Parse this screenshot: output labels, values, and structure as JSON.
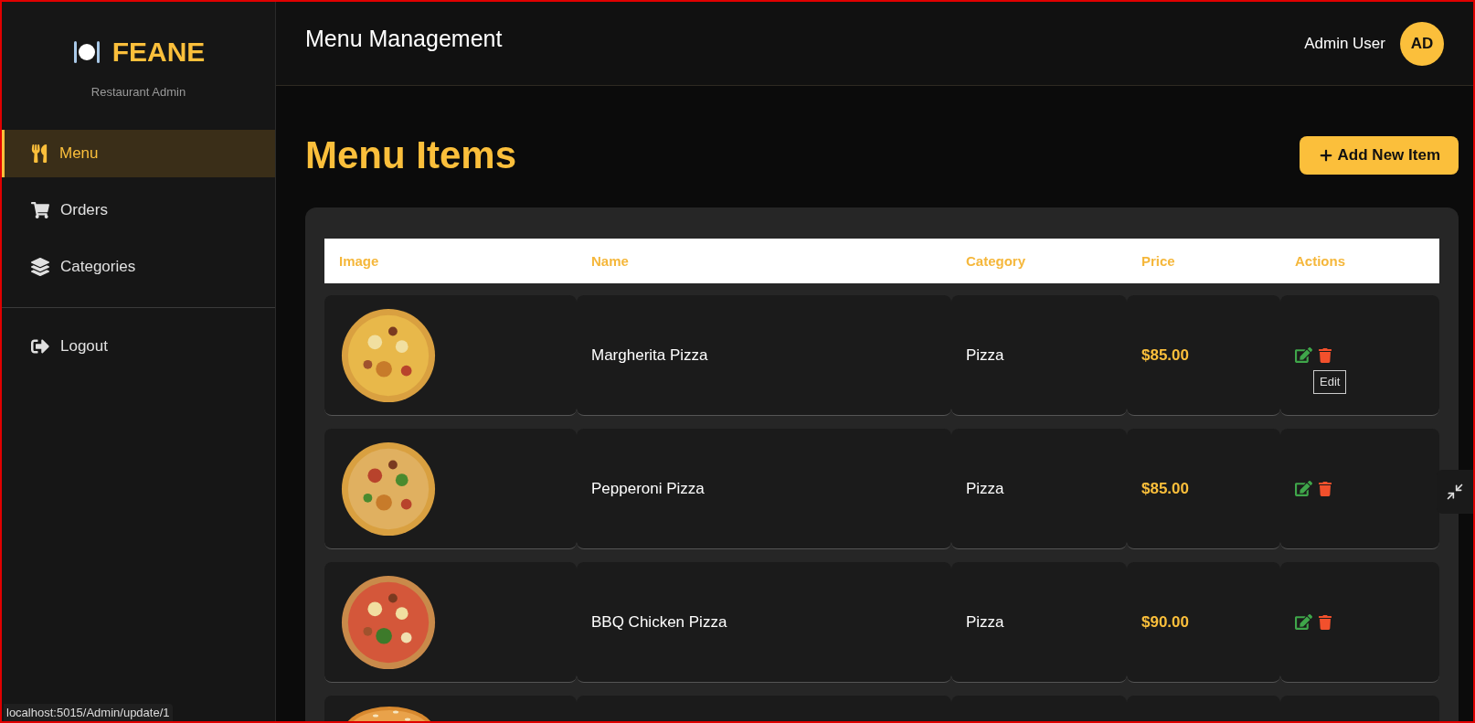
{
  "brand": {
    "name": "FEANE",
    "subtitle": "Restaurant Admin"
  },
  "sidebar": {
    "items": [
      {
        "label": "Menu",
        "selected": true
      },
      {
        "label": "Orders",
        "selected": false
      },
      {
        "label": "Categories",
        "selected": false
      }
    ],
    "footer_items": [
      {
        "label": "Logout"
      }
    ]
  },
  "header": {
    "title": "Menu Management",
    "user_name": "Admin User",
    "avatar_initials": "AD"
  },
  "page": {
    "title": "Menu Items",
    "add_button": "Add New Item"
  },
  "table": {
    "columns": [
      "Image",
      "Name",
      "Category",
      "Price",
      "Actions"
    ],
    "rows": [
      {
        "image": {
          "kind": "picture"
        },
        "name": "Margherita Pizza",
        "category": "Pizza",
        "price": "$85.00",
        "tooltip": "Edit"
      },
      {
        "image": {
          "kind": "picture"
        },
        "name": "Pepperoni Pizza",
        "category": "Pizza",
        "price": "$85.00"
      },
      {
        "image": {
          "kind": "picture"
        },
        "name": "BBQ Chicken Pizza",
        "category": "Pizza",
        "price": "$90.00"
      },
      {
        "image": {
          "kind": "picture"
        }
      }
    ]
  },
  "status_bar": {
    "url": "localhost:5015/Admin/update/1"
  }
}
